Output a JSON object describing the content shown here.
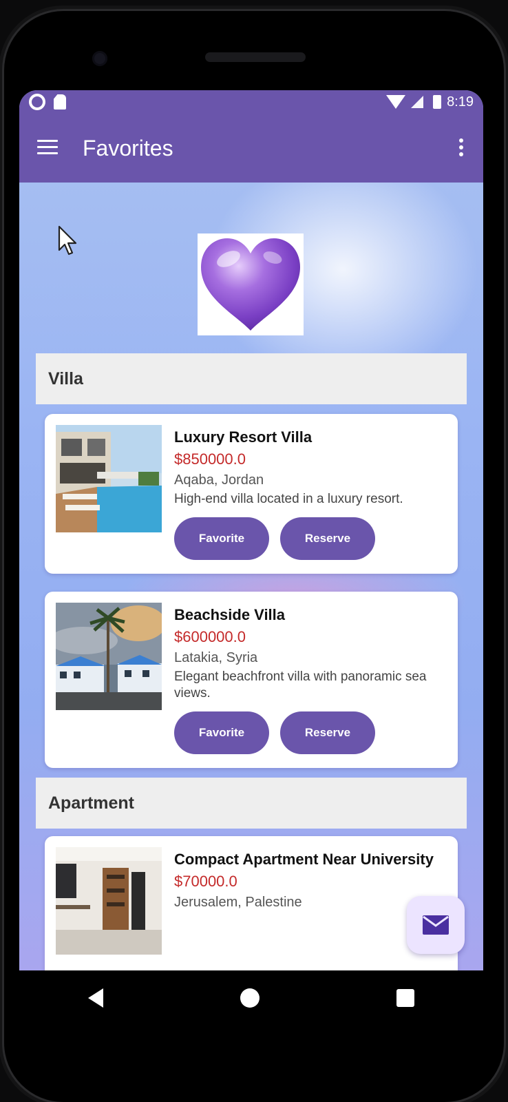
{
  "status_bar": {
    "time": "8:19"
  },
  "app_bar": {
    "title": "Favorites",
    "menu_icon": "hamburger-menu-icon",
    "more_icon": "more-vert-icon"
  },
  "sections": [
    {
      "title": "Villa",
      "items": [
        {
          "title": "Luxury Resort Villa",
          "price": "$850000.0",
          "location": "Aqaba, Jordan",
          "description": "High-end villa located in a luxury resort.",
          "favorite_label": "Favorite",
          "reserve_label": "Reserve"
        },
        {
          "title": "Beachside Villa",
          "price": "$600000.0",
          "location": "Latakia, Syria",
          "description": "Elegant beachfront villa with panoramic sea views.",
          "favorite_label": "Favorite",
          "reserve_label": "Reserve"
        }
      ]
    },
    {
      "title": "Apartment",
      "items": [
        {
          "title": "Compact Apartment Near University",
          "price": "$70000.0",
          "location": "Jerusalem, Palestine"
        }
      ]
    }
  ],
  "fab": {
    "icon": "mail-icon"
  },
  "colors": {
    "primary": "#6a55ab",
    "price": "#c42a2a",
    "fab_bg": "#ece4ff"
  }
}
